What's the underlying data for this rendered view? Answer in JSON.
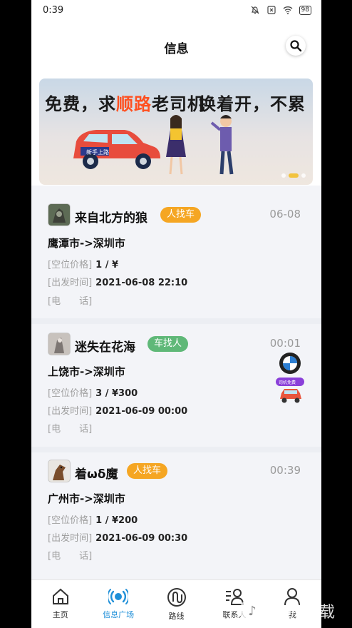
{
  "status": {
    "time": "0:39",
    "battery": "98"
  },
  "header": {
    "title": "信息"
  },
  "banner": {
    "text_left_1": "免费，求",
    "text_left_hl": "顺路",
    "text_left_2": "老司机",
    "text_right": "换着开，不累",
    "car_label": "新手上路",
    "accent": "#ff4f1f"
  },
  "posts": [
    {
      "name": "来自北方的狼",
      "tag": "人找车",
      "tag_color": "#f5a623",
      "time": "06-08",
      "route": "鹰潭市->深圳市",
      "price_label": "[空位价格]",
      "price": "1 / ¥",
      "depart_label": "[出发时间]",
      "depart": "2021-06-08 22:10",
      "phone_label": "[电　　话]"
    },
    {
      "name": "迷失在花海",
      "tag": "车找人",
      "tag_color": "#5fb878",
      "time": "00:01",
      "route": "上饶市->深圳市",
      "price_label": "[空位价格]",
      "price": "3 / ¥300",
      "depart_label": "[出发时间]",
      "depart": "2021-06-09 00:00",
      "phone_label": "[电　　话]"
    },
    {
      "name": "着ωδ魔",
      "tag": "人找车",
      "tag_color": "#f5a623",
      "time": "00:39",
      "route": "广州市->深圳市",
      "price_label": "[空位价格]",
      "price": "1 / ¥200",
      "depart_label": "[出发时间]",
      "depart": "2021-06-09 00:30",
      "phone_label": "[电　　话]"
    }
  ],
  "float_ad": {
    "label": "司机免费"
  },
  "tabs": [
    {
      "label": "主页",
      "icon": "home-icon"
    },
    {
      "label": "信息广场",
      "icon": "broadcast-icon",
      "active": true
    },
    {
      "label": "路线",
      "icon": "route-icon"
    },
    {
      "label": "联系人",
      "icon": "contacts-icon"
    },
    {
      "label": "我",
      "icon": "user-icon"
    }
  ],
  "watermark": {
    "text": "一听下载"
  }
}
